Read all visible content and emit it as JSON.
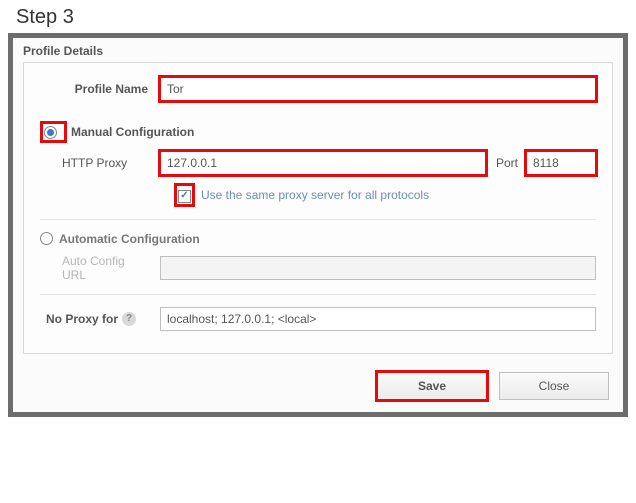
{
  "step_label": "Step 3",
  "panel_title": "Profile Details",
  "profile_name": {
    "label": "Profile Name",
    "value": "Tor"
  },
  "manual": {
    "label": "Manual Configuration",
    "selected": true,
    "http_proxy_label": "HTTP Proxy",
    "http_proxy_value": "127.0.0.1",
    "port_label": "Port",
    "port_value": "8118",
    "same_proxy_checked": true,
    "same_proxy_label": "Use the same proxy server for all protocols"
  },
  "auto": {
    "label": "Automatic Configuration",
    "selected": false,
    "url_label": "Auto Config URL",
    "url_value": ""
  },
  "no_proxy": {
    "label": "No Proxy for",
    "value": "localhost; 127.0.0.1; <local>"
  },
  "buttons": {
    "save": "Save",
    "close": "Close"
  }
}
